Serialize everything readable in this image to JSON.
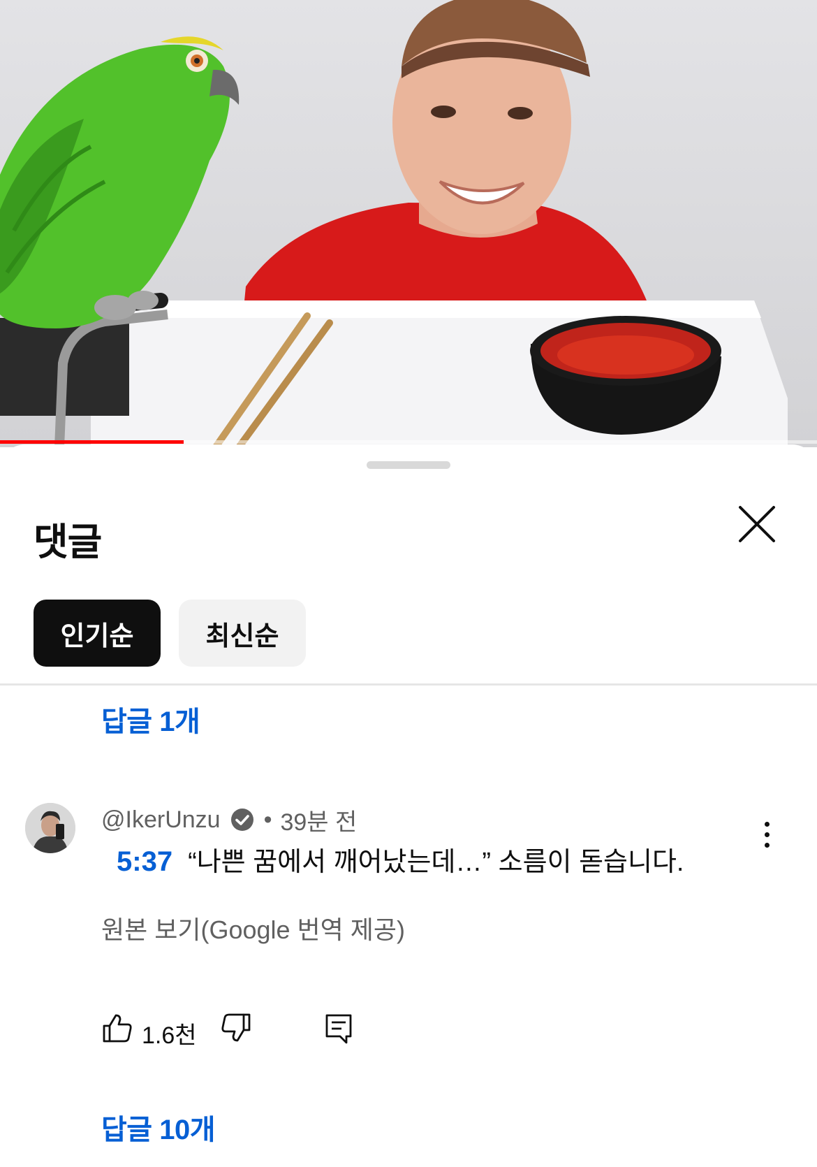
{
  "video": {
    "progress_fraction": 0.225,
    "progress_color": "#ff0000"
  },
  "sheet": {
    "title": "댓글",
    "close_icon": "close-icon",
    "sort_chips": [
      {
        "label": "인기순",
        "active": true
      },
      {
        "label": "최신순",
        "active": false
      }
    ]
  },
  "previous_comment": {
    "replies_label": "답글 1개"
  },
  "comment": {
    "author": "@IkerUnzu",
    "verified_icon": "verified-check-icon",
    "separator": "•",
    "age": "39분 전",
    "timestamp": "5:37",
    "text": "“나쁜 꿈에서 깨어났는데…” 소름이 돋습니다.",
    "translation_link": "원본 보기(Google 번역 제공)",
    "like_count": "1.6천",
    "replies_label": "답글 10개"
  },
  "colors": {
    "link_blue": "#065fd4",
    "chip_active_bg": "#0f0f0f",
    "chip_inactive_bg": "#f2f2f2",
    "secondary_text": "#606060"
  }
}
